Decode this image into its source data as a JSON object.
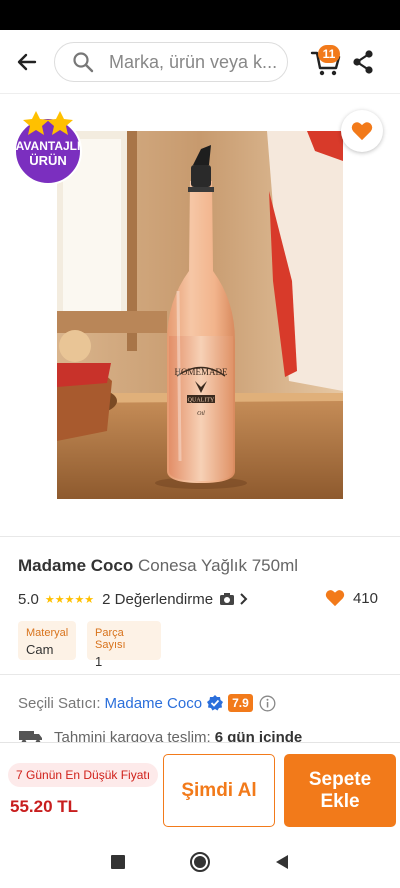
{
  "header": {
    "search_placeholder": "Marka, ürün veya k...",
    "cart_count": "11"
  },
  "badge": {
    "line1": "AVANTAJLI",
    "line2": "ÜRÜN"
  },
  "product": {
    "brand": "Madame Coco",
    "name": "Conesa Yağlık 750ml",
    "rating": "5.0",
    "stars": "★★★★★",
    "review_text": "2 Değerlendirme",
    "favorite_count": "410",
    "attributes": [
      {
        "label": "Materyal",
        "value": "Cam"
      },
      {
        "label": "Parça Sayısı",
        "value": "1"
      }
    ]
  },
  "seller": {
    "label": "Seçili Satıcı:",
    "name": "Madame Coco",
    "score": "7.9"
  },
  "shipping": {
    "label": "Tahmini kargoya teslim:",
    "value": "6 gün içinde"
  },
  "purchase": {
    "low_price_label": "7 Günün En Düşük Fiyatı",
    "price": "55.20 TL",
    "buy_now_label": "Şimdi Al",
    "add_to_cart_label": "Sepete Ekle"
  },
  "colors": {
    "accent": "#f27a1a",
    "price_red": "#c81e1e",
    "seller_blue": "#2b6fdb",
    "badge_purple": "#7b2fbf"
  }
}
